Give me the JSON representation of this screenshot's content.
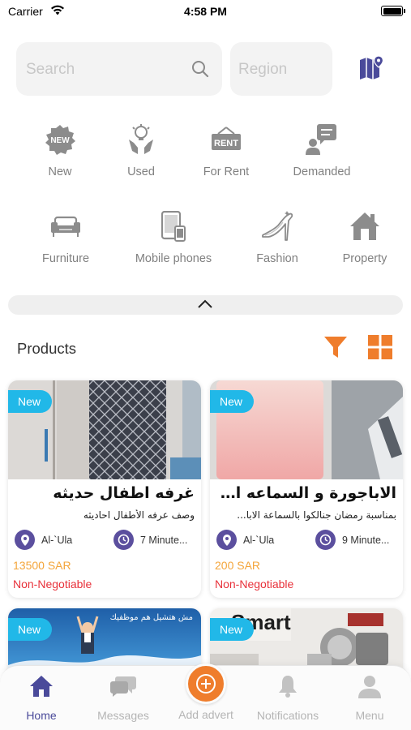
{
  "status_bar": {
    "carrier": "Carrier",
    "time": "4:58 PM"
  },
  "search": {
    "placeholder": "Search"
  },
  "region": {
    "placeholder": "Region"
  },
  "categories": [
    {
      "label": "New",
      "icon": "new-badge-icon"
    },
    {
      "label": "Used",
      "icon": "used-hand-icon"
    },
    {
      "label": "For Rent",
      "icon": "rent-sign-icon"
    },
    {
      "label": "Demanded",
      "icon": "demanded-user-icon"
    },
    {
      "label": "Furniture",
      "icon": "sofa-icon"
    },
    {
      "label": "Mobile phones",
      "icon": "mobile-phone-icon"
    },
    {
      "label": "Fashion",
      "icon": "high-heel-icon"
    },
    {
      "label": "Property",
      "icon": "house-icon"
    }
  ],
  "products_section": {
    "title": "Products"
  },
  "products": [
    {
      "badge": "New",
      "title": "غرفه اطفال حديثه",
      "description": "وصف عرفه الأطفال احاديثه",
      "location": "Al-`Ula",
      "time": "7 Minute...",
      "price": "13500 SAR",
      "negotiable": "Non-Negotiable"
    },
    {
      "badge": "New",
      "title": "الاباجورة و السماعه المو...",
      "description": "بمناسبة رمضان جنالكوا بالسماعة الابا...",
      "location": "Al-`Ula",
      "time": "9 Minute...",
      "price": "200 SAR",
      "negotiable": "Non-Negotiable"
    },
    {
      "badge": "New",
      "image_text": "مش هتشيل هم موظفيك"
    },
    {
      "badge": "New",
      "image_text": "Smart"
    }
  ],
  "tab_bar": {
    "home": "Home",
    "messages": "Messages",
    "add_advert": "Add advert",
    "notifications": "Notifications",
    "menu": "Menu"
  },
  "colors": {
    "accent_purple": "#4a4a9a",
    "accent_orange": "#ef7d2c",
    "badge_blue": "#21b8e8",
    "price_orange": "#f4a53a",
    "negotiable_red": "#e8313a",
    "meta_icon_purple": "#5b4f9e"
  }
}
